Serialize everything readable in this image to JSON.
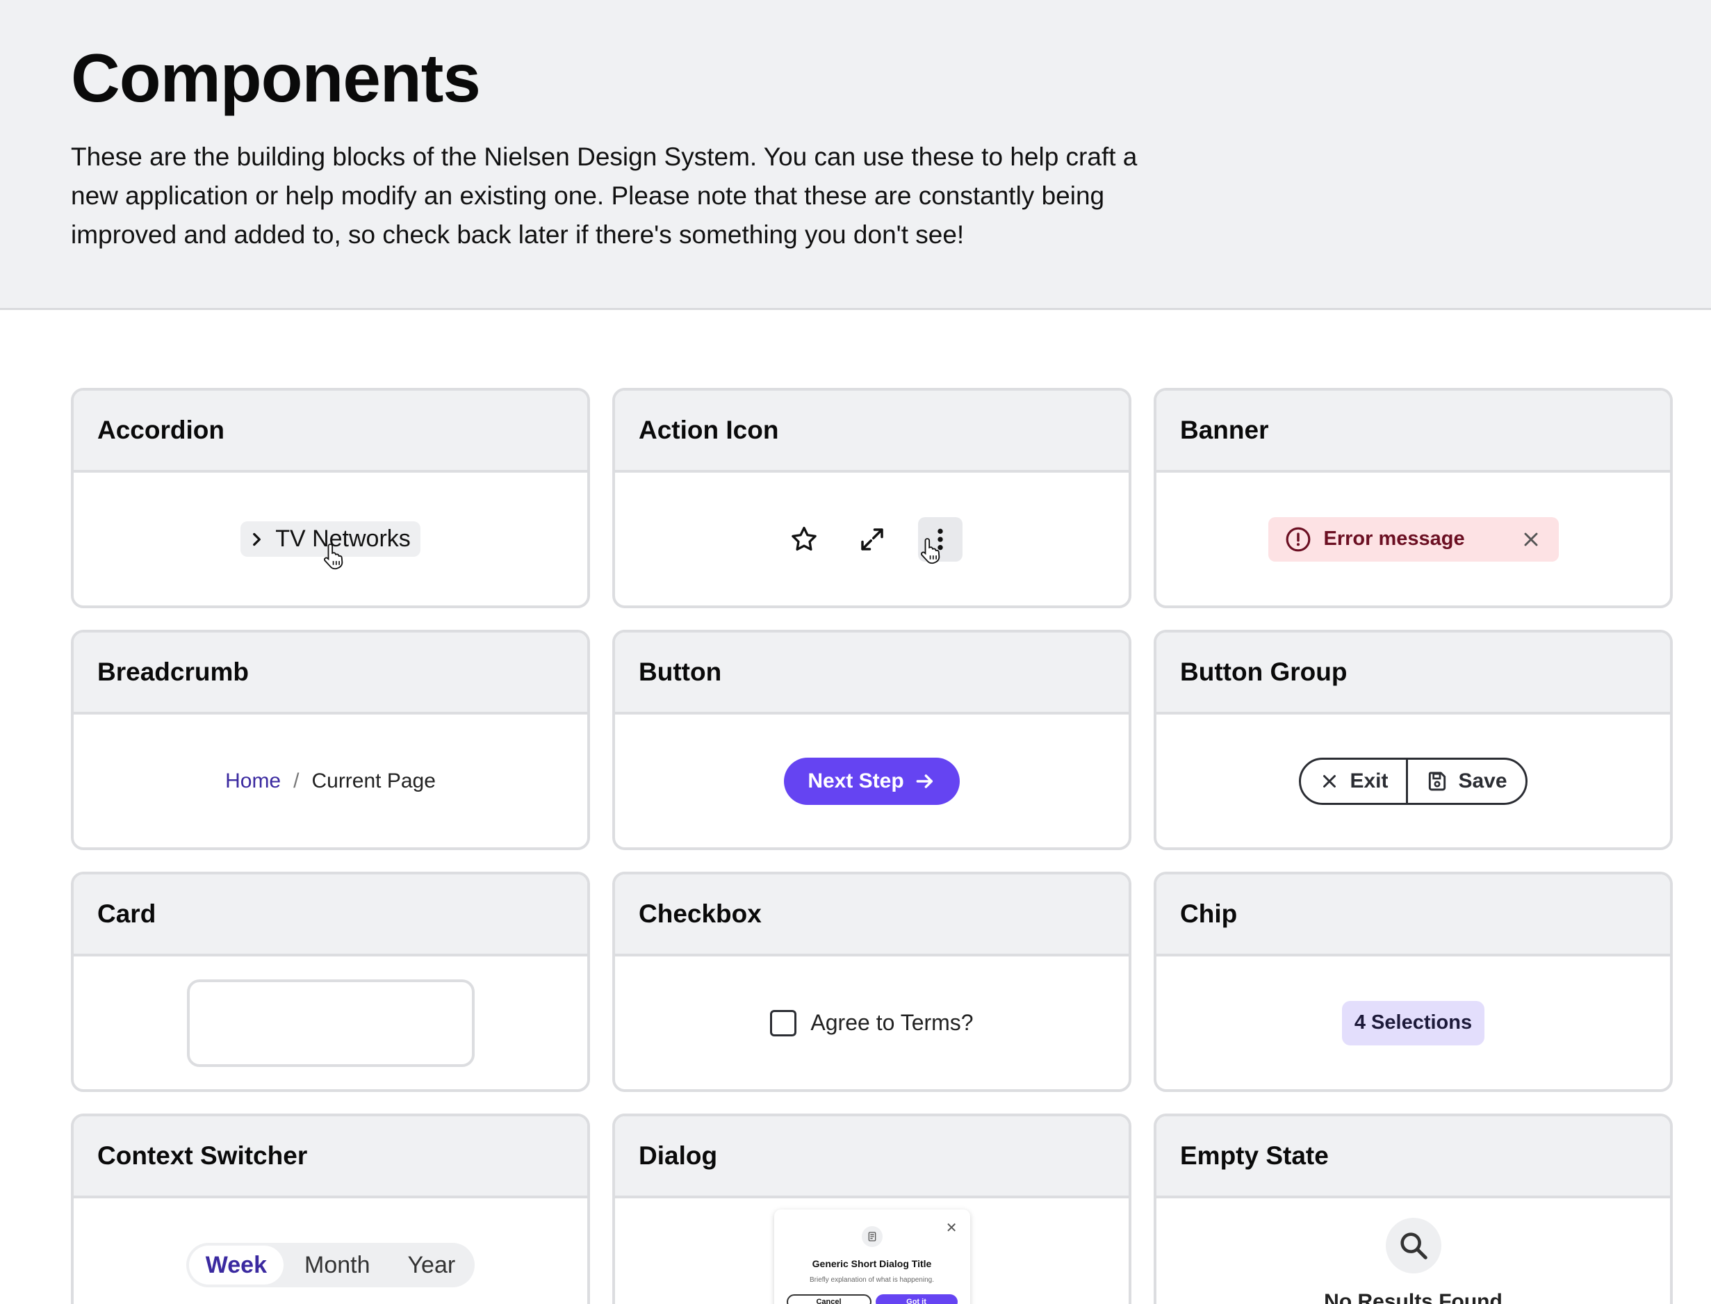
{
  "page": {
    "title": "Components",
    "intro": "These are the building blocks of the Nielsen Design System. You can use these to help craft a new application or help modify an existing one. Please note that these are constantly being improved and added to, so check back later if there's something you don't see!"
  },
  "cards": {
    "accordion": {
      "title": "Accordion",
      "label": "TV Networks"
    },
    "action_icon": {
      "title": "Action Icon",
      "icons": [
        "star-icon",
        "expand-icon",
        "more-vertical-icon"
      ]
    },
    "banner": {
      "title": "Banner",
      "message": "Error message"
    },
    "breadcrumb": {
      "title": "Breadcrumb",
      "home": "Home",
      "separator": "/",
      "current": "Current Page"
    },
    "button": {
      "title": "Button",
      "label": "Next Step"
    },
    "button_group": {
      "title": "Button Group",
      "exit": "Exit",
      "save": "Save"
    },
    "card": {
      "title": "Card"
    },
    "checkbox": {
      "title": "Checkbox",
      "label": "Agree to Terms?"
    },
    "chip": {
      "title": "Chip",
      "label": "4 Selections"
    },
    "context_switcher": {
      "title": "Context Switcher",
      "options": [
        "Week",
        "Month",
        "Year"
      ],
      "selected": "Week"
    },
    "dialog": {
      "title": "Dialog",
      "dialog_title": "Generic Short Dialog Title",
      "dialog_desc": "Briefly explanation of what is happening.",
      "cancel": "Cancel",
      "confirm": "Got it"
    },
    "empty_state": {
      "title": "Empty State",
      "message": "No Results Found"
    }
  },
  "colors": {
    "primary": "#6544f2",
    "link": "#3b2aa0",
    "error_bg": "#fde2e4",
    "error_text": "#6b0f22",
    "chip_bg": "#e3defc",
    "header_bg": "#f0f1f3"
  }
}
